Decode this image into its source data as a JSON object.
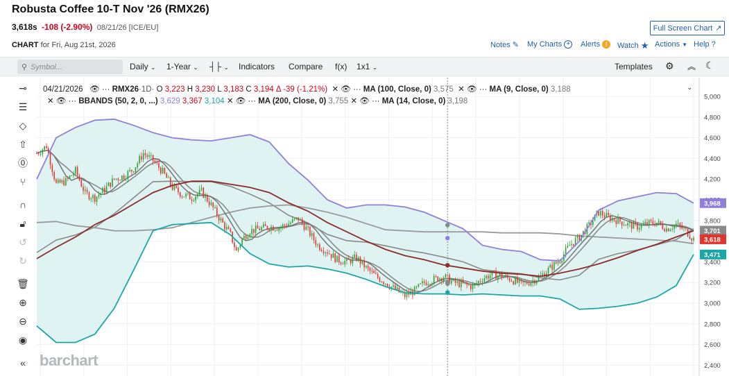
{
  "header": {
    "title": "Robusta Coffee 10-T Nov '26 (RMX26)",
    "last": "3,618s",
    "change": "-108 (-2.90%)",
    "meta": "08/21/26 [ICE/EU]",
    "chart_label": "CHART",
    "chart_date": "for Fri, Aug 21st, 2026",
    "full_screen_label": "Full Screen Chart"
  },
  "links": {
    "notes": "Notes",
    "my_charts": "My Charts",
    "alerts": "Alerts",
    "watch": "Watch",
    "actions": "Actions",
    "help": "Help"
  },
  "toolbar": {
    "symbol_placeholder": "Symbol...",
    "period": "Daily",
    "range": "1-Year",
    "indicators": "Indicators",
    "compare": "Compare",
    "fx": "f(x)",
    "layout": "1x1",
    "templates": "Templates"
  },
  "legend": {
    "date": "04/21/2026",
    "symbol": "RMX26",
    "interval": "·1D·",
    "open_label": "O",
    "open": "3,223",
    "high_label": "H",
    "high": "3,230",
    "low_label": "L",
    "low": "3,183",
    "close_label": "C",
    "close": "3,194",
    "delta": "Δ -39 (-1.21%)",
    "ma100": "MA (100, Close, 0)",
    "ma100_val": "3,575",
    "ma9": "MA (9, Close, 0)",
    "ma9_val": "3,188",
    "bbands": "BBANDS (50, 2, 0, ...)",
    "bb_upper": "3,629",
    "bb_mid": "3,367",
    "bb_lower": "3,104",
    "ma200": "MA (200, Close, 0)",
    "ma200_val": "3,755",
    "ma14": "MA (14, Close, 0)",
    "ma14_val": "3,198"
  },
  "price_badges": {
    "upper": "3,968",
    "ma200": "3,701",
    "last": "3,618",
    "lower": "3,471"
  },
  "watermark": "barchart",
  "colors": {
    "up": "#2ca02c",
    "down": "#e0342f",
    "bb_upper": "#8f7fd9",
    "bb_lower": "#1aa6a6",
    "bb_fill": "#dff3f3",
    "ma100": "#8b2b2b",
    "ma200": "#9a9a9a",
    "ma": "#7a7a7a",
    "link": "#1f5fa8"
  },
  "chart_data": {
    "type": "line",
    "yticks": [
      "5,000",
      "4,800",
      "4,600",
      "4,400",
      "4,200",
      "4,000",
      "3,800",
      "3,600",
      "3,400",
      "3,200",
      "3,000",
      "2,800",
      "2,600",
      "2,400"
    ],
    "ylim": [
      2400,
      5100
    ],
    "n_days": 252,
    "close": [
      [
        0,
        4450
      ],
      [
        5,
        4520
      ],
      [
        10,
        4150
      ],
      [
        15,
        4180
      ],
      [
        20,
        4280
      ],
      [
        25,
        4060
      ],
      [
        30,
        4020
      ],
      [
        35,
        4100
      ],
      [
        40,
        4200
      ],
      [
        45,
        4230
      ],
      [
        50,
        4300
      ],
      [
        55,
        4450
      ],
      [
        60,
        4380
      ],
      [
        65,
        4270
      ],
      [
        70,
        4120
      ],
      [
        75,
        4050
      ],
      [
        80,
        4020
      ],
      [
        85,
        4080
      ],
      [
        90,
        3950
      ],
      [
        95,
        3800
      ],
      [
        100,
        3660
      ],
      [
        103,
        3500
      ],
      [
        106,
        3620
      ],
      [
        110,
        3700
      ],
      [
        115,
        3720
      ],
      [
        120,
        3740
      ],
      [
        125,
        3730
      ],
      [
        130,
        3770
      ],
      [
        135,
        3820
      ],
      [
        140,
        3700
      ],
      [
        145,
        3560
      ],
      [
        150,
        3500
      ],
      [
        155,
        3420
      ],
      [
        160,
        3400
      ],
      [
        165,
        3440
      ],
      [
        170,
        3340
      ],
      [
        175,
        3260
      ],
      [
        180,
        3200
      ],
      [
        185,
        3130
      ],
      [
        190,
        3070
      ],
      [
        195,
        3120
      ],
      [
        200,
        3200
      ],
      [
        205,
        3230
      ],
      [
        210,
        3260
      ],
      [
        215,
        3200
      ],
      [
        220,
        3180
      ],
      [
        225,
        3160
      ],
      [
        230,
        3240
      ],
      [
        235,
        3280
      ],
      [
        240,
        3260
      ],
      [
        245,
        3230
      ],
      [
        250,
        3180
      ],
      [
        255,
        3210
      ],
      [
        260,
        3260
      ],
      [
        265,
        3340
      ],
      [
        270,
        3420
      ],
      [
        275,
        3560
      ],
      [
        280,
        3640
      ],
      [
        285,
        3750
      ],
      [
        290,
        3880
      ],
      [
        295,
        3830
      ],
      [
        300,
        3800
      ],
      [
        305,
        3760
      ],
      [
        310,
        3740
      ],
      [
        315,
        3770
      ],
      [
        320,
        3780
      ],
      [
        325,
        3720
      ],
      [
        330,
        3760
      ],
      [
        335,
        3700
      ],
      [
        339,
        3618
      ]
    ],
    "bb_upper": [
      [
        0,
        4200
      ],
      [
        10,
        4600
      ],
      [
        20,
        4700
      ],
      [
        30,
        4770
      ],
      [
        40,
        4780
      ],
      [
        50,
        4720
      ],
      [
        60,
        4650
      ],
      [
        70,
        4600
      ],
      [
        80,
        4580
      ],
      [
        90,
        4570
      ],
      [
        100,
        4600
      ],
      [
        110,
        4630
      ],
      [
        120,
        4560
      ],
      [
        130,
        4350
      ],
      [
        140,
        4190
      ],
      [
        150,
        4000
      ],
      [
        160,
        3920
      ],
      [
        170,
        3950
      ],
      [
        180,
        3950
      ],
      [
        190,
        3930
      ],
      [
        200,
        3880
      ],
      [
        210,
        3800
      ],
      [
        220,
        3720
      ],
      [
        230,
        3560
      ],
      [
        240,
        3520
      ],
      [
        250,
        3500
      ],
      [
        260,
        3420
      ],
      [
        270,
        3410
      ],
      [
        280,
        3600
      ],
      [
        290,
        3900
      ],
      [
        300,
        3990
      ],
      [
        310,
        4030
      ],
      [
        320,
        4070
      ],
      [
        330,
        4060
      ],
      [
        339,
        3968
      ]
    ],
    "bb_lower": [
      [
        0,
        2780
      ],
      [
        10,
        2620
      ],
      [
        20,
        2620
      ],
      [
        30,
        2700
      ],
      [
        40,
        2950
      ],
      [
        50,
        3320
      ],
      [
        60,
        3700
      ],
      [
        70,
        3760
      ],
      [
        80,
        3770
      ],
      [
        90,
        3780
      ],
      [
        100,
        3660
      ],
      [
        110,
        3480
      ],
      [
        120,
        3380
      ],
      [
        130,
        3350
      ],
      [
        140,
        3360
      ],
      [
        150,
        3330
      ],
      [
        160,
        3290
      ],
      [
        170,
        3230
      ],
      [
        180,
        3160
      ],
      [
        190,
        3100
      ],
      [
        200,
        3090
      ],
      [
        210,
        3090
      ],
      [
        220,
        3080
      ],
      [
        230,
        3090
      ],
      [
        240,
        3080
      ],
      [
        250,
        3070
      ],
      [
        260,
        3070
      ],
      [
        270,
        3040
      ],
      [
        280,
        2940
      ],
      [
        290,
        2950
      ],
      [
        300,
        2970
      ],
      [
        310,
        3000
      ],
      [
        320,
        3060
      ],
      [
        330,
        3170
      ],
      [
        339,
        3471
      ]
    ],
    "ma100": [
      [
        0,
        3430
      ],
      [
        10,
        3540
      ],
      [
        20,
        3640
      ],
      [
        30,
        3760
      ],
      [
        40,
        3850
      ],
      [
        50,
        3960
      ],
      [
        60,
        4070
      ],
      [
        70,
        4140
      ],
      [
        80,
        4180
      ],
      [
        90,
        4180
      ],
      [
        100,
        4150
      ],
      [
        110,
        4120
      ],
      [
        120,
        4070
      ],
      [
        130,
        3970
      ],
      [
        140,
        3890
      ],
      [
        150,
        3780
      ],
      [
        160,
        3690
      ],
      [
        170,
        3600
      ],
      [
        180,
        3520
      ],
      [
        190,
        3460
      ],
      [
        200,
        3420
      ],
      [
        210,
        3370
      ],
      [
        220,
        3340
      ],
      [
        230,
        3310
      ],
      [
        240,
        3290
      ],
      [
        250,
        3280
      ],
      [
        260,
        3260
      ],
      [
        270,
        3290
      ],
      [
        280,
        3330
      ],
      [
        290,
        3380
      ],
      [
        300,
        3440
      ],
      [
        310,
        3510
      ],
      [
        320,
        3570
      ],
      [
        330,
        3640
      ],
      [
        339,
        3701
      ]
    ],
    "ma200": [
      [
        0,
        3780
      ],
      [
        10,
        3790
      ],
      [
        20,
        3750
      ],
      [
        30,
        3730
      ],
      [
        40,
        3700
      ],
      [
        50,
        3700
      ],
      [
        60,
        3710
      ],
      [
        70,
        3730
      ],
      [
        80,
        3780
      ],
      [
        90,
        3830
      ],
      [
        100,
        3880
      ],
      [
        110,
        3920
      ],
      [
        120,
        3940
      ],
      [
        130,
        3950
      ],
      [
        140,
        3920
      ],
      [
        150,
        3880
      ],
      [
        160,
        3830
      ],
      [
        170,
        3770
      ],
      [
        180,
        3710
      ],
      [
        190,
        3700
      ],
      [
        200,
        3690
      ],
      [
        210,
        3690
      ],
      [
        220,
        3690
      ],
      [
        230,
        3690
      ],
      [
        240,
        3680
      ],
      [
        250,
        3680
      ],
      [
        260,
        3680
      ],
      [
        270,
        3670
      ],
      [
        280,
        3650
      ],
      [
        290,
        3640
      ],
      [
        300,
        3630
      ],
      [
        310,
        3620
      ],
      [
        320,
        3610
      ],
      [
        330,
        3600
      ],
      [
        339,
        3575
      ]
    ]
  }
}
